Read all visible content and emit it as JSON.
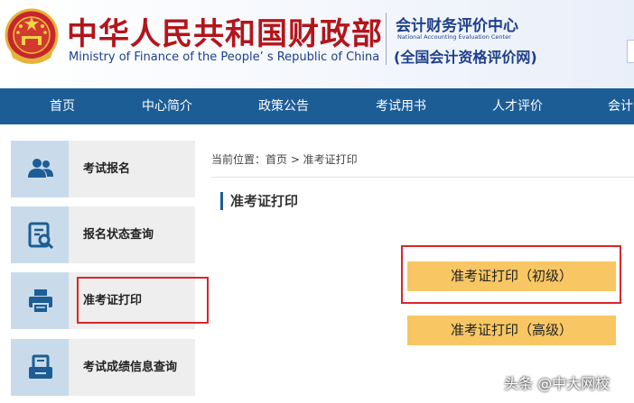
{
  "header": {
    "title_cn": "中华人民共和国财政部",
    "title_en": "Ministry of Finance of the People’ s Republic of China",
    "center_cn": "会计财务评价中心",
    "center_en": "National Accounting Evaluation Center",
    "center_sub": "(全国会计资格评价网)"
  },
  "nav": {
    "items": [
      {
        "label": "首页"
      },
      {
        "label": "中心简介"
      },
      {
        "label": "政策公告"
      },
      {
        "label": "考试用书"
      },
      {
        "label": "人才评价"
      },
      {
        "label": "会计"
      }
    ]
  },
  "sidebar": {
    "items": [
      {
        "label": "考试报名",
        "icon": "users-icon"
      },
      {
        "label": "报名状态查询",
        "icon": "search-document-icon"
      },
      {
        "label": "准考证打印",
        "icon": "printer-icon"
      },
      {
        "label": "考试成绩信息查询",
        "icon": "score-query-icon"
      }
    ]
  },
  "main": {
    "breadcrumb": "当前位置：首页 > 准考证打印",
    "section_title": "准考证打印",
    "btn_junior": "准考证打印（初级）",
    "btn_senior": "准考证打印（高级）"
  },
  "watermark": "头条 @中大网校",
  "colors": {
    "nav_bg": "#1d5d96",
    "title_red": "#b3151b",
    "brand_blue": "#1d3f8c",
    "button_yellow": "#f8c763",
    "highlight_red": "#d9262c",
    "sidebar_bg": "#eeeeee",
    "sidebar_icon_bg": "#c9dbea"
  }
}
